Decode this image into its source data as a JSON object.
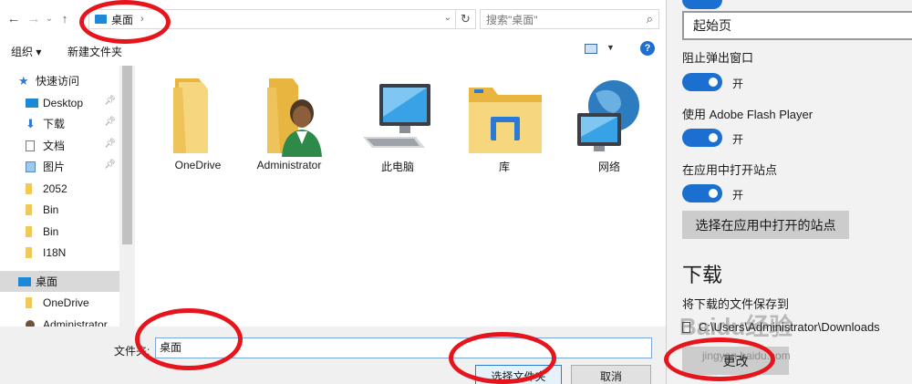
{
  "dialog": {
    "breadcrumb": "桌面",
    "search_placeholder": "搜索\"桌面\"",
    "toolbar": {
      "organize": "组织 ▾",
      "new_folder": "新建文件夹"
    },
    "nav_items": [
      {
        "label": "快速访问",
        "icon": "star-icon"
      },
      {
        "label": "Desktop",
        "icon": "desktop-icon",
        "pinned": true
      },
      {
        "label": "下载",
        "icon": "download-icon",
        "pinned": true
      },
      {
        "label": "文档",
        "icon": "document-icon",
        "pinned": true
      },
      {
        "label": "图片",
        "icon": "picture-icon",
        "pinned": true
      },
      {
        "label": "2052",
        "icon": "folder-icon"
      },
      {
        "label": "Bin",
        "icon": "folder-icon"
      },
      {
        "label": "Bin",
        "icon": "folder-icon"
      },
      {
        "label": "I18N",
        "icon": "folder-icon"
      },
      {
        "label": "桌面",
        "icon": "desktop-icon",
        "selected": true
      },
      {
        "label": "OneDrive",
        "icon": "folder-icon"
      },
      {
        "label": "Administrator",
        "icon": "user-icon"
      }
    ],
    "items": [
      {
        "label": "OneDrive",
        "icon": "folder-icon"
      },
      {
        "label": "Administrator",
        "icon": "user-folder-icon"
      },
      {
        "label": "此电脑",
        "icon": "computer-icon"
      },
      {
        "label": "库",
        "icon": "library-icon"
      },
      {
        "label": "网络",
        "icon": "network-icon"
      }
    ],
    "filename_label": "文件夹:",
    "filename_value": "桌面",
    "select_button": "选择文件夹",
    "cancel_button": "取消"
  },
  "panel": {
    "start_page": "起始页",
    "block_popups": {
      "label": "阻止弹出窗口",
      "state": "开"
    },
    "flash": {
      "label": "使用 Adobe Flash Player",
      "state": "开"
    },
    "open_in_app": {
      "label": "在应用中打开站点",
      "state": "开"
    },
    "choose_sites_button": "选择在应用中打开的站点",
    "downloads_heading": "下载",
    "save_to_label": "将下载的文件保存到",
    "save_path": "C:\\Users\\Administrator\\Downloads",
    "change_button": "更改"
  },
  "watermark": {
    "text": "Baidu经验",
    "url": "jingyan.baidu.com"
  },
  "colors": {
    "accent": "#1b6fd1",
    "annotation": "#e8141c",
    "folder": "#f1c95a"
  }
}
